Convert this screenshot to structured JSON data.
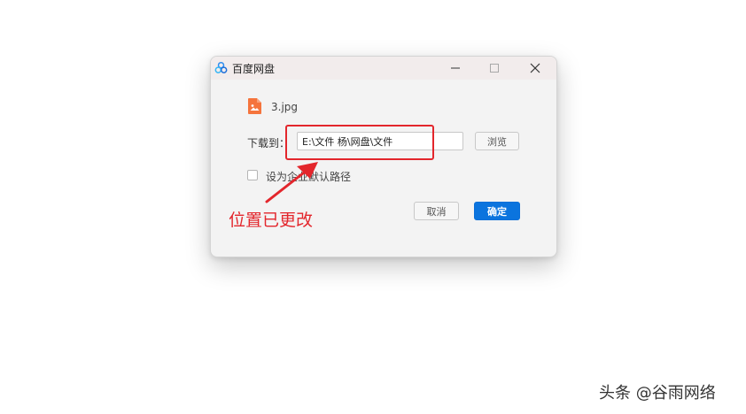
{
  "window": {
    "title": "百度网盘",
    "controls": [
      "minimize-icon",
      "maximize-icon",
      "close-icon"
    ]
  },
  "file": {
    "name": "3.jpg",
    "icon": "image-file-icon",
    "icon_color": "#f5743c"
  },
  "download": {
    "label": "下载到：",
    "path_value": "E:\\文件 杨\\网盘\\文件",
    "browse_label": "浏览"
  },
  "default_path": {
    "label": "设为企业默认路径",
    "checked": false
  },
  "actions": {
    "cancel_label": "取消",
    "ok_label": "确定"
  },
  "annotation": {
    "text": "位置已更改",
    "color": "#e3262c"
  },
  "watermark": "头条 @谷雨网络",
  "colors": {
    "primary": "#0b74de",
    "annotation": "#e3262c"
  }
}
